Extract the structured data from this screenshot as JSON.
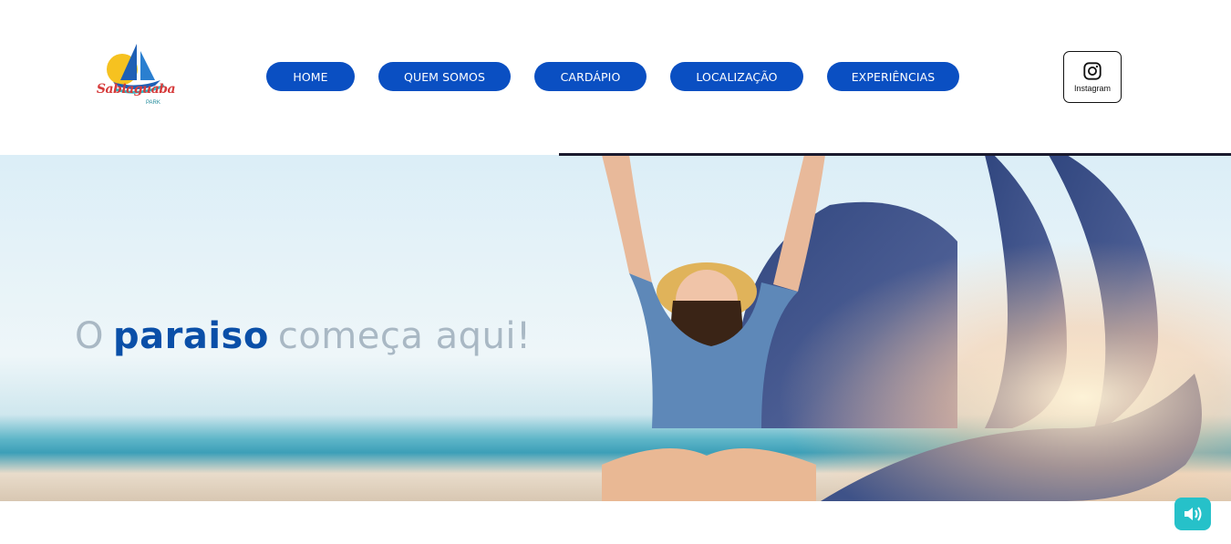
{
  "logo": {
    "brand_text": "Sabiaguaba",
    "sub_text": "PARK"
  },
  "nav": {
    "items": [
      {
        "label": "HOME"
      },
      {
        "label": "QUEM SOMOS"
      },
      {
        "label": "CARDÁPIO"
      },
      {
        "label": "LOCALIZAÇÃO"
      },
      {
        "label": "EXPERIÊNCIAS"
      }
    ]
  },
  "social": {
    "instagram_label": "Instagram",
    "icon": "instagram-icon"
  },
  "hero": {
    "title_part1": "O",
    "title_part2": "paraiso",
    "title_part3": "começa aqui!"
  },
  "sound_button": {
    "icon": "volume-icon"
  },
  "colors": {
    "nav_bg": "#0a4fc2",
    "accent_teal": "#26c1c9",
    "sail_navy": "#2f4a87",
    "title_bold": "#0a4fa8",
    "logo_red": "#d63b3b"
  }
}
